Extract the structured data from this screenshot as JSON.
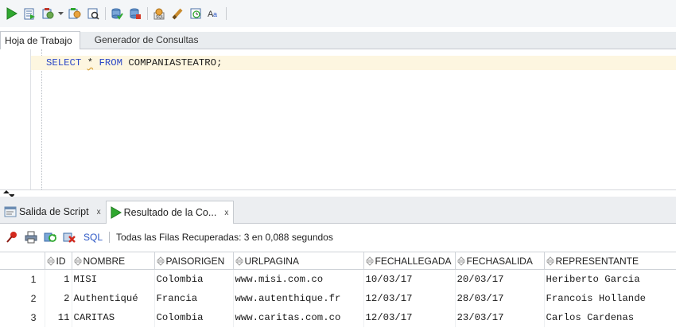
{
  "toolbar": {
    "buttons": [
      "run-statement-icon",
      "run-script-icon",
      "autotrace-icon",
      "explain-plan-icon",
      "sql-tuning-icon",
      "commit-icon",
      "rollback-icon",
      "unshared-sql-icon",
      "clear-icon",
      "history-icon",
      "case-format-icon"
    ]
  },
  "worksheet_tabs": {
    "active": "Hoja de Trabajo",
    "inactive": "Generador de Consultas"
  },
  "editor": {
    "kw_select": "SELECT",
    "star": "*",
    "kw_from": "FROM",
    "table": "COMPANIASTEATRO;"
  },
  "result_tabs": {
    "script_output": "Salida de Script",
    "query_result": "Resultado de la Co...",
    "close": "x"
  },
  "result_toolbar": {
    "sql_label": "SQL",
    "status": "Todas las Filas Recuperadas: 3 en 0,088 segundos"
  },
  "grid": {
    "columns": [
      "ID",
      "NOMBRE",
      "PAISORIGEN",
      "URLPAGINA",
      "FECHALLEGADA",
      "FECHASALIDA",
      "REPRESENTANTE"
    ],
    "rows": [
      {
        "n": "1",
        "id": "1",
        "nombre": "MISI",
        "pais": "Colombia",
        "url": "www.misi.com.co",
        "llegada": "10/03/17",
        "salida": "20/03/17",
        "rep": "Heriberto Garcia"
      },
      {
        "n": "2",
        "id": "2",
        "nombre": "Authentiqué",
        "pais": "Francia",
        "url": "www.autenthique.fr",
        "llegada": "12/03/17",
        "salida": "28/03/17",
        "rep": "Francois Hollande"
      },
      {
        "n": "3",
        "id": "11",
        "nombre": "CARITAS",
        "pais": "Colombia",
        "url": "www.caritas.com.co",
        "llegada": "12/03/17",
        "salida": "23/03/17",
        "rep": "Carlos Cardenas"
      }
    ]
  },
  "colors": {
    "keyword": "#2b47c7",
    "current_line": "#fdf6e0",
    "run_green": "#2fa82f",
    "link_blue": "#2c57c5"
  }
}
